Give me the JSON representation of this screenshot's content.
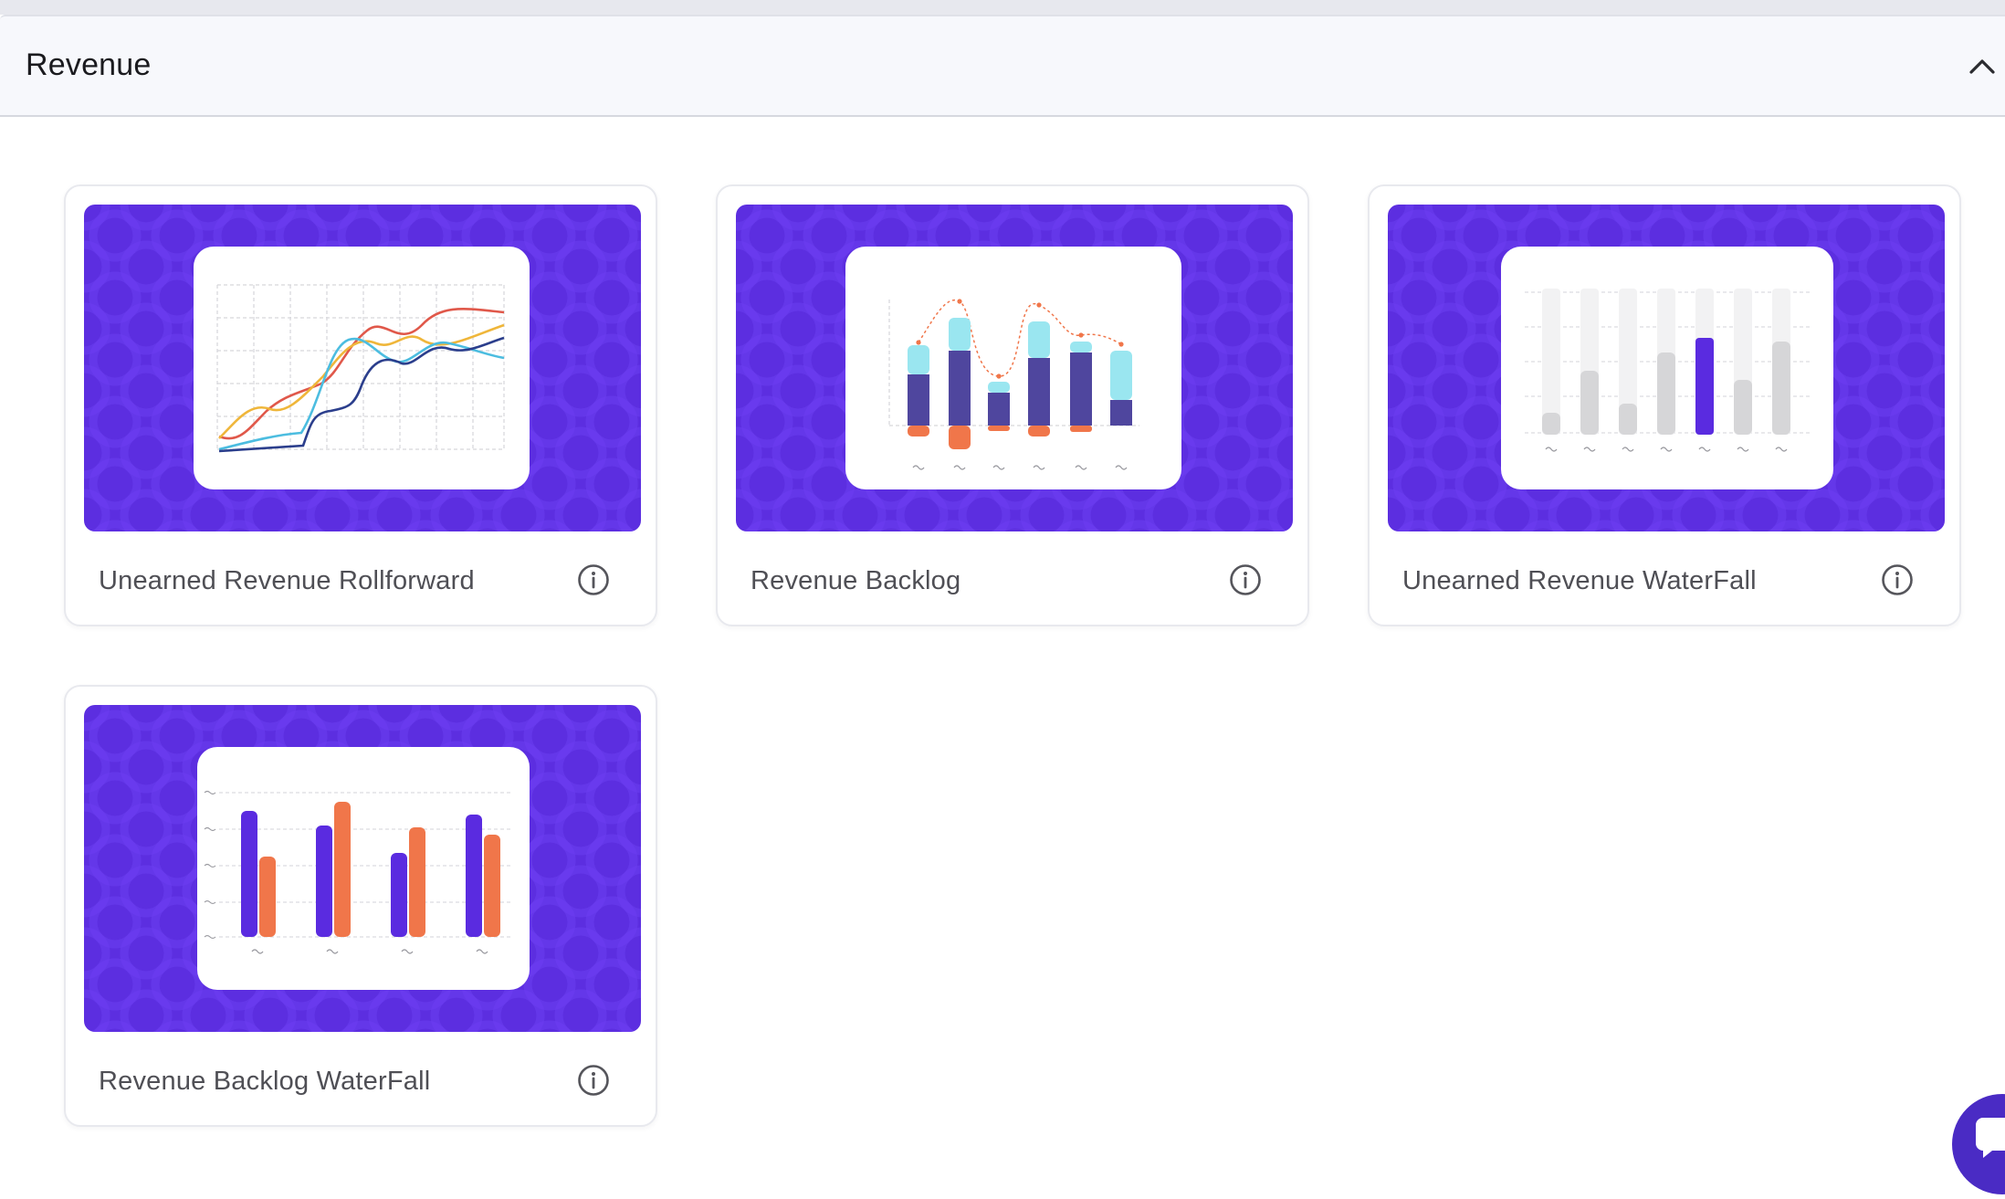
{
  "section": {
    "title": "Revenue",
    "collapse_icon": "chevron-up-icon"
  },
  "brand_colors": {
    "thumbnail_background": "#5c2ee0",
    "accent_orange": "#f0764a",
    "accent_cyan": "#9ae6f0",
    "accent_navy": "#4f469e"
  },
  "reports": [
    {
      "title": "Unearned Revenue Rollforward",
      "preview": "multi-line-chart",
      "info_icon": "info-icon"
    },
    {
      "title": "Revenue Backlog",
      "preview": "stacked-bar-chart",
      "info_icon": "info-icon"
    },
    {
      "title": "Unearned Revenue WaterFall",
      "preview": "waterfall-bar-chart",
      "info_icon": "info-icon"
    },
    {
      "title": "Revenue Backlog WaterFall",
      "preview": "grouped-bar-chart",
      "info_icon": "info-icon"
    }
  ],
  "chat_launcher": {
    "icon": "chat-icon"
  }
}
